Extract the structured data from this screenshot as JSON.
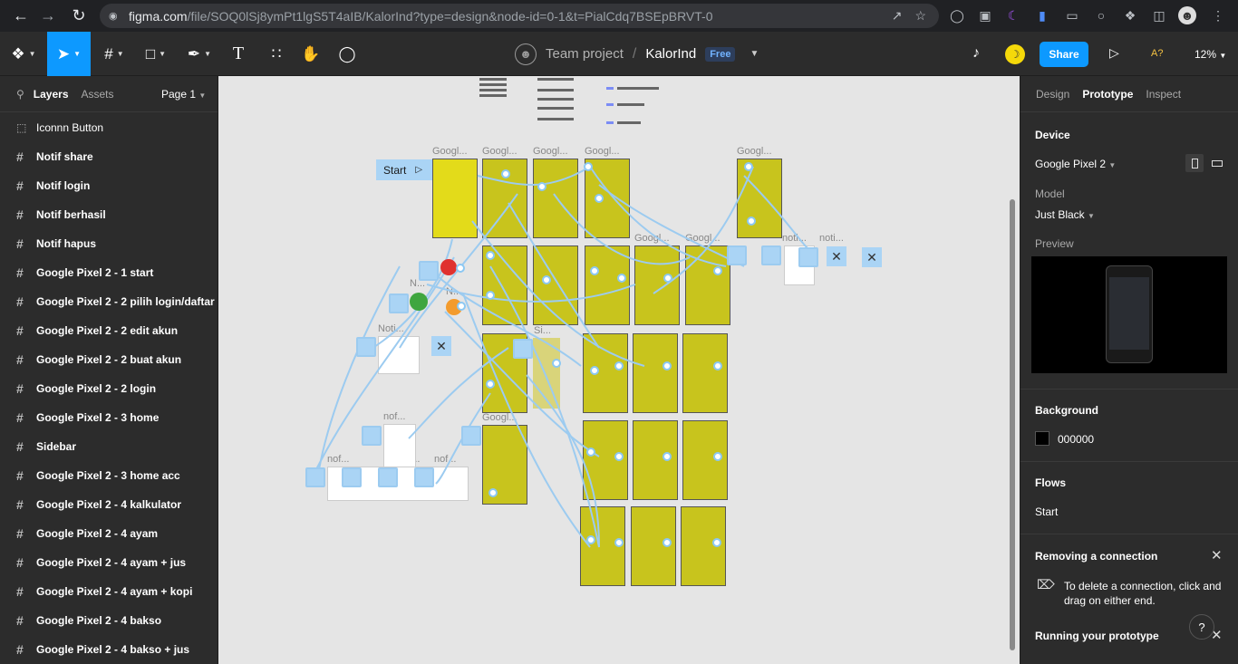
{
  "browser": {
    "url_host": "figma.com",
    "url_path": "/file/SOQ0lSj8ymPt1lgS5T4aIB/KalorInd?type=design&node-id=0-1&t=PialCdq7BSEpBRVT-0"
  },
  "toolbar": {
    "team": "Team project",
    "separator": "/",
    "file_name": "KalorInd",
    "plan_badge": "Free",
    "share_label": "Share",
    "a11y_label": "A?",
    "zoom": "12%"
  },
  "left_panel": {
    "tab_layers": "Layers",
    "tab_assets": "Assets",
    "page_selector": "Page 1",
    "layers": [
      "Iconnn Button",
      "Notif share",
      "Notif login",
      "Notif berhasil",
      "Notif hapus",
      "Google Pixel 2 - 1 start",
      "Google Pixel 2 - 2 pilih login/daftar",
      "Google Pixel 2 - 2 edit akun",
      "Google Pixel 2 - 2 buat akun",
      "Google Pixel 2 - 2 login",
      "Google Pixel 2 - 3 home",
      "Sidebar",
      "Google Pixel 2 - 3 home acc",
      "Google Pixel 2 - 4 kalkulator",
      "Google Pixel 2 - 4 ayam",
      "Google Pixel 2 - 4 ayam + jus",
      "Google Pixel 2 - 4 ayam + kopi",
      "Google Pixel 2 - 4 bakso",
      "Google Pixel 2 - 4 bakso + jus"
    ]
  },
  "canvas": {
    "start_label": "Start",
    "frame_labels": [
      "Googl...",
      "Googl...",
      "Googl...",
      "Googl...",
      "Googl...",
      "Googl...",
      "Googl...",
      "Googl...",
      "noti...",
      "noti...",
      "Noti...",
      "N...",
      "N...",
      "Si...",
      "nof...",
      "nof...",
      "not...",
      "nof..."
    ]
  },
  "right_panel": {
    "tab_design": "Design",
    "tab_prototype": "Prototype",
    "tab_inspect": "Inspect",
    "device_title": "Device",
    "device_value": "Google Pixel 2",
    "model_label": "Model",
    "model_value": "Just Black",
    "preview_label": "Preview",
    "background_title": "Background",
    "background_hex": "000000",
    "flows_title": "Flows",
    "flow_name": "Start",
    "tip_title": "Removing a connection",
    "tip_text": "To delete a connection, click and drag on either end.",
    "running_title": "Running your prototype",
    "help_label": "?"
  },
  "colors": {
    "accent": "#0d99ff",
    "frame_yellow": "#c8c41d",
    "connector_blue": "#9ccbf0"
  }
}
